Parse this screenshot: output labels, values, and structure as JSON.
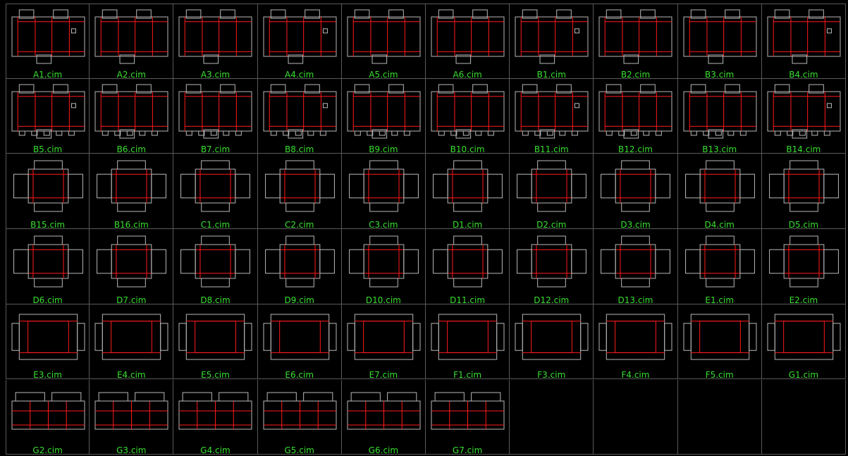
{
  "colors": {
    "background": "#000000",
    "grid_line": "#5a5a5a",
    "label": "#38e030",
    "outline": "#b8b8b8",
    "crease": "#ff1a1a"
  },
  "grid": {
    "columns": 10,
    "rows": 6
  },
  "cells": [
    "A1.cim",
    "A2.cim",
    "A3.cim",
    "A4.cim",
    "A5.cim",
    "A6.cim",
    "B1.cim",
    "B2.cim",
    "B3.cim",
    "B4.cim",
    "B5.cim",
    "B6.cim",
    "B7.cim",
    "B8.cim",
    "B9.cim",
    "B10.cim",
    "B11.cim",
    "B12.cim",
    "B13.cim",
    "B14.cim",
    "B15.cim",
    "B16.cim",
    "C1.cim",
    "C2.cim",
    "C3.cim",
    "D1.cim",
    "D2.cim",
    "D3.cim",
    "D4.cim",
    "D5.cim",
    "D6.cim",
    "D7.cim",
    "D8.cim",
    "D9.cim",
    "D10.cim",
    "D11.cim",
    "D12.cim",
    "D13.cim",
    "E1.cim",
    "E2.cim",
    "E3.cim",
    "E4.cim",
    "E5.cim",
    "E6.cim",
    "E7.cim",
    "F1.cim",
    "F3.cim",
    "F4.cim",
    "F5.cim",
    "G1.cim",
    "G2.cim",
    "G3.cim",
    "G4.cim",
    "G5.cim",
    "G6.cim",
    "G7.cim",
    "",
    "",
    "",
    ""
  ]
}
